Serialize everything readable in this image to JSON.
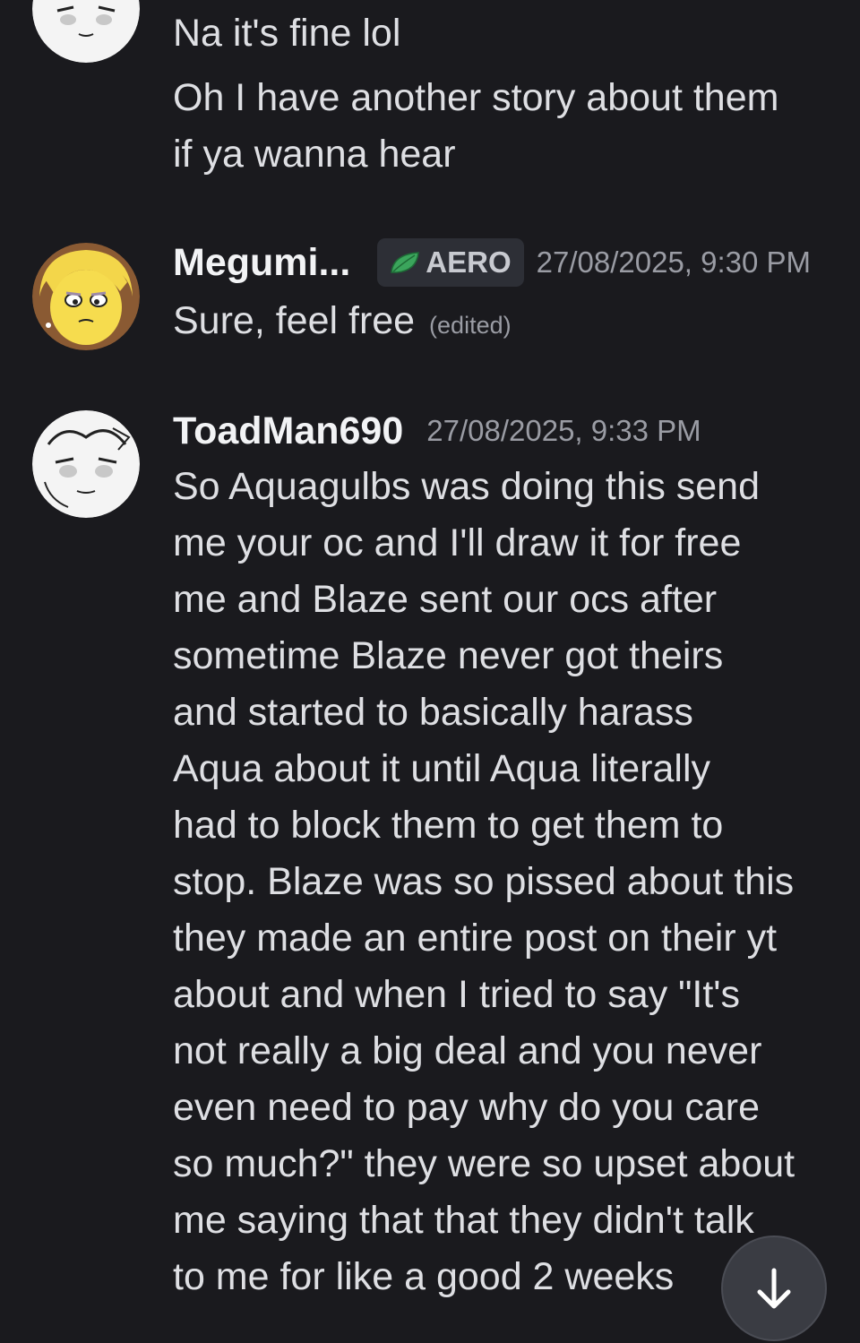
{
  "messages": [
    {
      "continuation": true,
      "lines": [
        "Na it's fine lol",
        "Oh I have another story about them\nif ya wanna hear"
      ]
    },
    {
      "username": "Megumi...",
      "badge": "AERO",
      "timestamp": "27/08/2025, 9:30 PM",
      "text": "Sure, feel free",
      "edited": "(edited)"
    },
    {
      "username": "ToadMan690",
      "timestamp": "27/08/2025, 9:33 PM",
      "text": "So Aquagulbs was doing this send\nme your oc and I'll draw it for free\nme and Blaze sent our ocs after\nsometime Blaze never got theirs\nand started to basically harass\nAqua about it until Aqua literally\nhad to block them to get them to\nstop. Blaze was so pissed about this\nthey made an entire post on their yt\nabout and when I tried to say \"It's\nnot really a big deal and you never\neven need to pay why do you care\nso much?\" they were so upset about\nme saying that that they didn't talk\nto me for like a good 2 weeks"
    }
  ],
  "icons": {
    "badge_icon": "green-leaf-icon",
    "scroll_button_icon": "arrow-down-icon"
  },
  "colors": {
    "background": "#1a1a1e",
    "badge_leaf": "#3ba55c",
    "scroll_button": "#3a3c43"
  }
}
